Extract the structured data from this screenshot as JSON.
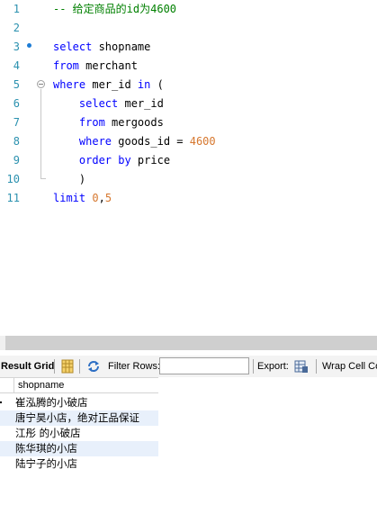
{
  "editor": {
    "lines": [
      {
        "num": "1",
        "tokens": [
          {
            "t": "-- 给定商品的id为4600",
            "c": "cm"
          }
        ]
      },
      {
        "num": "2",
        "tokens": []
      },
      {
        "num": "3",
        "tokens": [
          {
            "t": "select",
            "c": "kw"
          },
          {
            "t": " shopname",
            "c": ""
          }
        ]
      },
      {
        "num": "4",
        "tokens": [
          {
            "t": "from",
            "c": "kw"
          },
          {
            "t": " merchant",
            "c": ""
          }
        ]
      },
      {
        "num": "5",
        "tokens": [
          {
            "t": "where",
            "c": "kw"
          },
          {
            "t": " mer_id ",
            "c": ""
          },
          {
            "t": "in",
            "c": "kw"
          },
          {
            "t": " (",
            "c": ""
          }
        ]
      },
      {
        "num": "6",
        "tokens": [
          {
            "t": "    ",
            "c": ""
          },
          {
            "t": "select",
            "c": "kw"
          },
          {
            "t": " mer_id",
            "c": ""
          }
        ]
      },
      {
        "num": "7",
        "tokens": [
          {
            "t": "    ",
            "c": ""
          },
          {
            "t": "from",
            "c": "kw"
          },
          {
            "t": " mergoods",
            "c": ""
          }
        ]
      },
      {
        "num": "8",
        "tokens": [
          {
            "t": "    ",
            "c": ""
          },
          {
            "t": "where",
            "c": "kw"
          },
          {
            "t": " goods_id = ",
            "c": ""
          },
          {
            "t": "4600",
            "c": "num"
          }
        ]
      },
      {
        "num": "9",
        "tokens": [
          {
            "t": "    ",
            "c": ""
          },
          {
            "t": "order by",
            "c": "kw"
          },
          {
            "t": " price",
            "c": ""
          }
        ]
      },
      {
        "num": "10",
        "tokens": [
          {
            "t": "    )",
            "c": ""
          }
        ]
      },
      {
        "num": "11",
        "tokens": [
          {
            "t": "limit",
            "c": "kw"
          },
          {
            "t": " ",
            "c": ""
          },
          {
            "t": "0",
            "c": "num"
          },
          {
            "t": ",",
            "c": ""
          },
          {
            "t": "5",
            "c": "num"
          }
        ]
      }
    ]
  },
  "toolbar": {
    "result_grid_label": "Result Grid",
    "filter_rows_label": "Filter Rows:",
    "filter_value": "",
    "export_label": "Export:",
    "wrap_label": "Wrap Cell Co"
  },
  "grid": {
    "column": "shopname",
    "rows": [
      "崔泓腾的小破店",
      "唐宁昊小店，绝对正品保证",
      "江彤 的小破店",
      "陈华琪的小店",
      "陆宁子的小店"
    ]
  }
}
